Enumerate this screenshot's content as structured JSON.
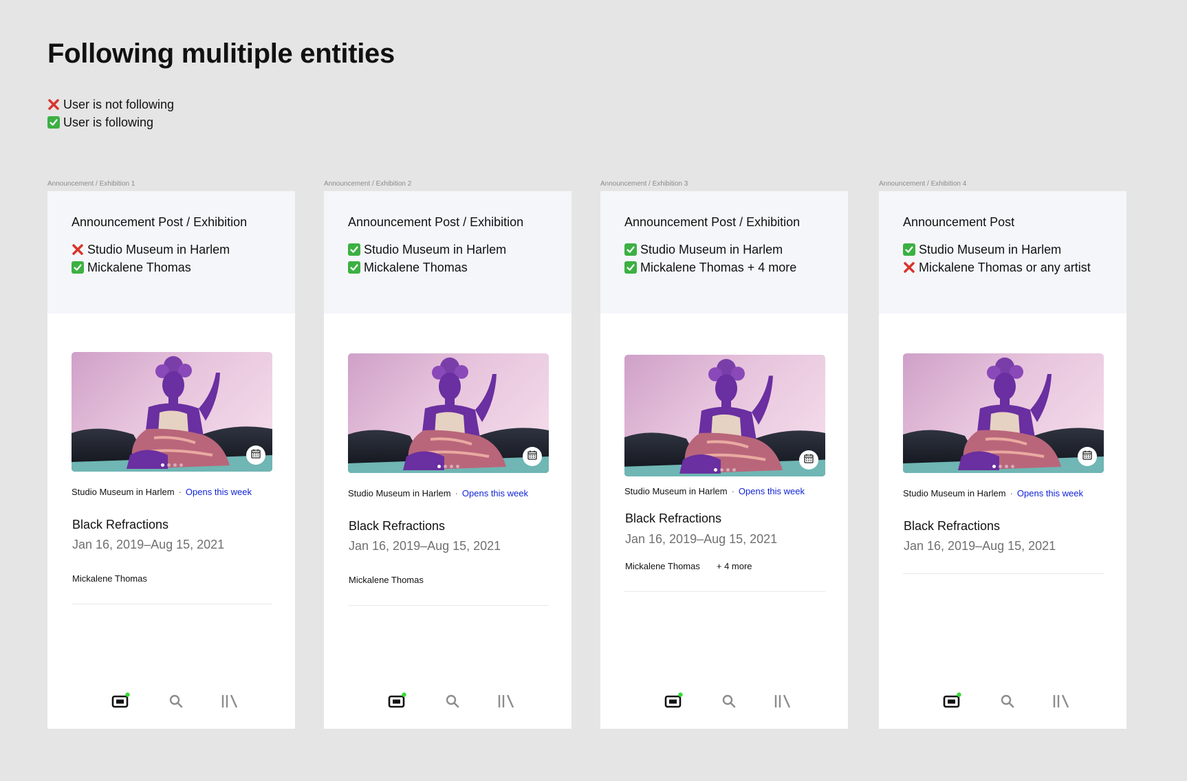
{
  "page": {
    "title": "Following mulitiple entities",
    "legend": {
      "not_following": "User is not following",
      "following": "User is following"
    }
  },
  "colors": {
    "background": "#e5e5e5",
    "card": "#ffffff",
    "card_header": "#f5f6fa",
    "link_blue": "#1023d7",
    "check_green": "#3cb043",
    "cross_red": "#d9342b",
    "notification_dot": "#33dd33"
  },
  "cards": [
    {
      "frame_label": "Announcement / Exhibition 1",
      "header_title": "Announcement Post / Exhibition",
      "conditions": [
        {
          "state": "cross",
          "text": "Studio Museum in Harlem"
        },
        {
          "state": "check",
          "text": "Mickalene Thomas"
        }
      ],
      "venue": "Studio Museum in Harlem",
      "separator": "·",
      "status": "Opens this week",
      "exhibition_title": "Black Refractions",
      "dates": "Jan 16, 2019–Aug 15, 2021",
      "artist": "Mickalene Thomas",
      "more": ""
    },
    {
      "frame_label": "Announcement / Exhibition 2",
      "header_title": "Announcement Post / Exhibition",
      "conditions": [
        {
          "state": "check",
          "text": "Studio Museum in Harlem"
        },
        {
          "state": "check",
          "text": "Mickalene Thomas"
        }
      ],
      "venue": "Studio Museum in Harlem",
      "separator": "·",
      "status": "Opens this week",
      "exhibition_title": "Black Refractions",
      "dates": "Jan 16, 2019–Aug 15, 2021",
      "artist": "Mickalene Thomas",
      "more": ""
    },
    {
      "frame_label": "Announcement / Exhibition 3",
      "header_title": "Announcement Post / Exhibition",
      "conditions": [
        {
          "state": "check",
          "text": "Studio Museum in Harlem"
        },
        {
          "state": "check",
          "text": "Mickalene Thomas + 4 more"
        }
      ],
      "venue": "Studio Museum in Harlem",
      "separator": "·",
      "status": "Opens this week",
      "exhibition_title": "Black Refractions",
      "dates": "Jan 16, 2019–Aug 15, 2021",
      "artist": "Mickalene Thomas",
      "more": "+ 4 more"
    },
    {
      "frame_label": "Announcement / Exhibition 4",
      "header_title": "Announcement Post",
      "conditions": [
        {
          "state": "check",
          "text": "Studio Museum in Harlem"
        },
        {
          "state": "cross",
          "text": "Mickalene Thomas or any artist"
        }
      ],
      "venue": "Studio Museum in Harlem",
      "separator": "·",
      "status": "Opens this week",
      "exhibition_title": "Black Refractions",
      "dates": "Jan 16, 2019–Aug 15, 2021",
      "artist": "",
      "more": ""
    }
  ],
  "tabbar": {
    "icons": [
      "feed-icon",
      "search-icon",
      "library-icon"
    ]
  }
}
